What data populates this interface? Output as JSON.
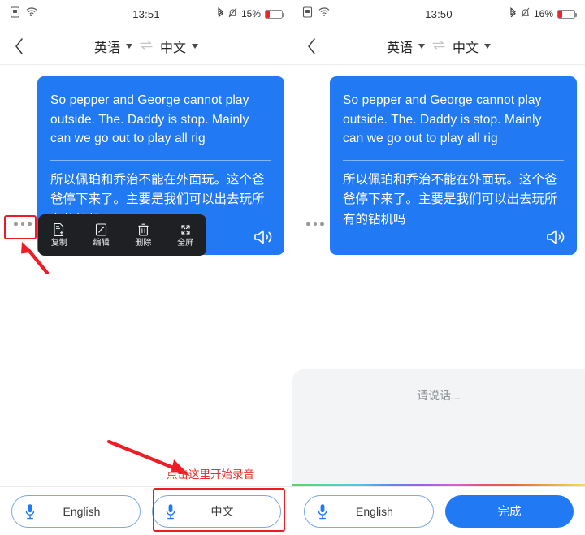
{
  "colors": {
    "bubble_blue": "#2179f3",
    "accent_blue": "#2179f3",
    "annotation_red": "#ed2b2b",
    "menu_dark": "#1f2024",
    "sheet_gray": "#f2f4f6",
    "battery_red": "#e8262c"
  },
  "left": {
    "statusbar": {
      "sim_icon": "sim-card-icon",
      "wifi_icon": "wifi-icon",
      "time": "13:51",
      "bluetooth_icon": "bluetooth-icon",
      "silent_icon": "silent-mode-icon",
      "battery_percent": "15%",
      "battery_icon": "battery-low-icon",
      "battery_level": 15
    },
    "appbar": {
      "back_icon": "chevron-left-icon",
      "source_language": "英语",
      "swap_icon": "swap-arrows-icon",
      "target_language": "中文"
    },
    "message": {
      "more_icon": "more-options-icon",
      "source_text": "So pepper and George cannot play outside.  The.  Daddy is stop. Mainly can we go out to play all rig",
      "translated_text": "所以佩珀和乔治不能在外面玩。这个爸爸停下来了。主要是我们可以出去玩所有的钻机吗",
      "speaker_icon": "speaker-icon"
    },
    "context_menu": [
      {
        "icon": "copy-icon",
        "label": "复制"
      },
      {
        "icon": "edit-pencil-icon",
        "label": "编辑"
      },
      {
        "icon": "trash-icon",
        "label": "删除"
      },
      {
        "icon": "fullscreen-icon",
        "label": "全屏"
      }
    ],
    "annotations": {
      "more_button_highlight": "highlight-box-more-button",
      "arrow_to_more": "red-arrow-pointing-up-left",
      "arrow_to_mic": "red-arrow-pointing-down-right",
      "mic_button_highlight": "highlight-box-chinese-mic-button",
      "hint_text": "点击这里开始录音"
    },
    "bottombar": {
      "left_mic_icon": "microphone-icon",
      "left_mic_label": "English",
      "right_mic_icon": "microphone-icon",
      "right_mic_label": "中文"
    }
  },
  "right": {
    "statusbar": {
      "sim_icon": "sim-card-icon",
      "wifi_icon": "wifi-icon",
      "time": "13:50",
      "bluetooth_icon": "bluetooth-icon",
      "silent_icon": "silent-mode-icon",
      "battery_percent": "16%",
      "battery_icon": "battery-low-icon",
      "battery_level": 16
    },
    "appbar": {
      "back_icon": "chevron-left-icon",
      "source_language": "英语",
      "swap_icon": "swap-arrows-icon",
      "target_language": "中文"
    },
    "message": {
      "more_icon": "more-options-icon",
      "source_text": "So pepper and George cannot play outside.  The.  Daddy is stop. Mainly can we go out to play all rig",
      "translated_text": "所以佩珀和乔治不能在外面玩。这个爸爸停下来了。主要是我们可以出去玩所有的钻机吗",
      "speaker_icon": "speaker-icon"
    },
    "recording": {
      "hint": "请说话...",
      "waveform": "rainbow-gradient-waveform"
    },
    "bottombar": {
      "mic_icon": "microphone-icon",
      "mic_label": "English",
      "done_label": "完成"
    }
  }
}
